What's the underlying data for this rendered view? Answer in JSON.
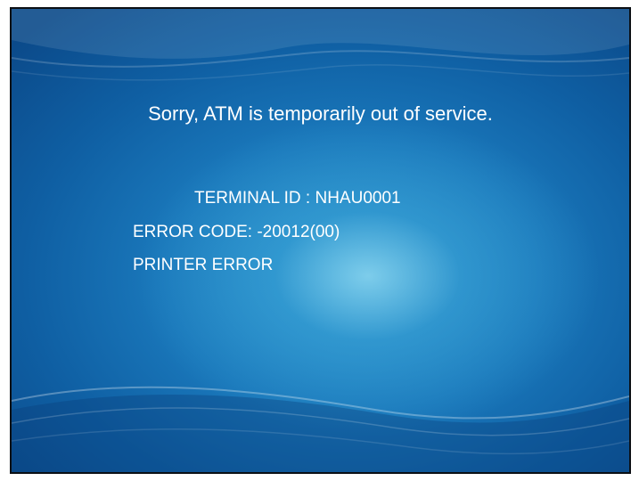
{
  "screen": {
    "message": "Sorry, ATM is temporarily out of service.",
    "terminal_id": "TERMINAL ID : NHAU0001",
    "error_code": "ERROR CODE: -20012(00)",
    "error_description": "PRINTER ERROR"
  },
  "colors": {
    "background_dark": "#0b4a8a",
    "background_mid": "#1a78bb",
    "background_glow": "#8cd7f0",
    "text": "#ffffff"
  }
}
